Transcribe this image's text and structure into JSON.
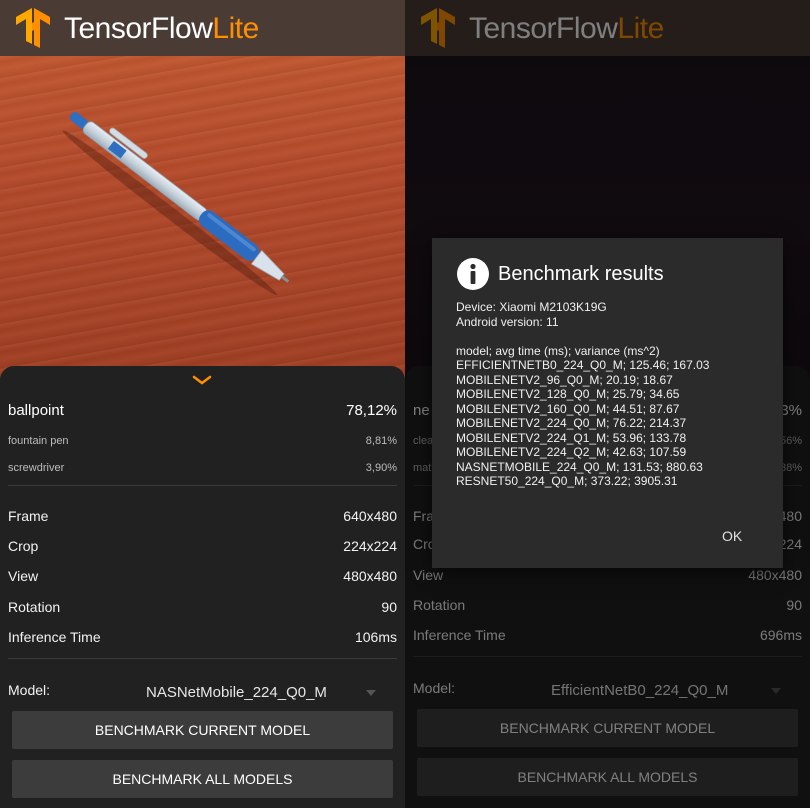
{
  "brand": {
    "name": "TensorFlow",
    "suffix": "Lite",
    "logo_icon": "tensorflow-logo-icon",
    "accent": "#ff8f00",
    "header_color": "#4a3b35"
  },
  "left": {
    "chevron_icon": "chevron-down-icon",
    "results": [
      {
        "label": "ballpoint",
        "score": "78,12%"
      },
      {
        "label": "fountain pen",
        "score": "8,81%"
      },
      {
        "label": "screwdriver",
        "score": "3,90%"
      }
    ],
    "info": [
      {
        "label": "Frame",
        "value": "640x480"
      },
      {
        "label": "Crop",
        "value": "224x224"
      },
      {
        "label": "View",
        "value": "480x480"
      },
      {
        "label": "Rotation",
        "value": "90"
      },
      {
        "label": "Inference Time",
        "value": "106ms"
      }
    ],
    "model_label": "Model:",
    "model_value": "NASNetMobile_224_Q0_M",
    "benchmark_current": "BENCHMARK CURRENT MODEL",
    "benchmark_all": "BENCHMARK ALL MODELS"
  },
  "right": {
    "results_partial": [
      {
        "label": "ne",
        "score": "3%"
      },
      {
        "label": "clea",
        "score": "56%"
      },
      {
        "label": "mat",
        "score": "38%"
      }
    ],
    "info": [
      {
        "label": "Frame",
        "value": "480"
      },
      {
        "label": "Crop",
        "value": "224"
      },
      {
        "label": "View",
        "value": "480x480"
      },
      {
        "label": "Rotation",
        "value": "90"
      },
      {
        "label": "Inference Time",
        "value": "696ms"
      }
    ],
    "model_label": "Model:",
    "model_value": "EfficientNetB0_224_Q0_M",
    "benchmark_current": "BENCHMARK CURRENT MODEL",
    "benchmark_all": "BENCHMARK ALL MODELS"
  },
  "dialog": {
    "icon": "info-icon",
    "title": "Benchmark results",
    "device": "Device: Xiaomi M2103K19G",
    "android": "Android version: 11",
    "header": "model; avg time (ms); variance (ms^2)",
    "lines": [
      "EFFICIENTNETB0_224_Q0_M; 125.46; 167.03",
      "MOBILENETV2_96_Q0_M; 20.19; 18.67",
      "MOBILENETV2_128_Q0_M; 25.79; 34.65",
      "MOBILENETV2_160_Q0_M; 44.51; 87.67",
      "MOBILENETV2_224_Q0_M; 76.22; 214.37",
      "MOBILENETV2_224_Q1_M; 53.96; 133.78",
      "MOBILENETV2_224_Q2_M; 42.63; 107.59",
      "NASNETMOBILE_224_Q0_M; 131.53; 880.63",
      "RESNET50_224_Q0_M; 373.22; 3905.31"
    ],
    "ok": "OK"
  }
}
